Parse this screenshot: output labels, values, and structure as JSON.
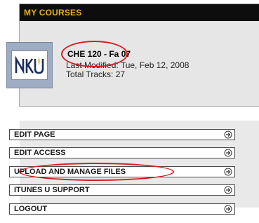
{
  "my_courses": {
    "header": "MY COURSES",
    "course": {
      "logo_text": "NKU",
      "title": "CHE 120 - Fa 07",
      "last_modified": "Last Modified: Tue, Feb 12, 2008",
      "total_tracks": "Total Tracks: 27"
    }
  },
  "menu": {
    "items": [
      {
        "label": "EDIT PAGE",
        "icon": "circle-arrow-right-icon"
      },
      {
        "label": "EDIT ACCESS",
        "icon": "circle-arrow-right-icon"
      },
      {
        "label": "UPLOAD AND MANAGE FILES",
        "icon": "circle-arrow-right-icon"
      },
      {
        "label": "ITUNES U SUPPORT",
        "icon": "circle-arrow-right-icon"
      },
      {
        "label": "LOGOUT",
        "icon": "circle-arrow-right-icon"
      }
    ]
  },
  "annotation_color": "#d81e1e",
  "header_text_color": "#e8b021"
}
